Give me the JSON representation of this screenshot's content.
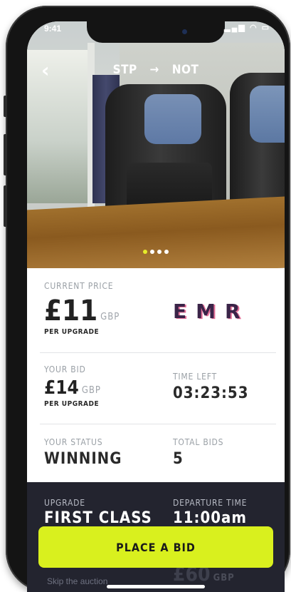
{
  "status_bar": {
    "time": "9:41",
    "icons": "signal wifi battery"
  },
  "nav": {
    "back_glyph": "‹",
    "origin": "STP",
    "arrow": "→",
    "destination": "NOT"
  },
  "carousel": {
    "count": 4,
    "active_index": 0,
    "active_color": "#e6ec2a"
  },
  "current_price": {
    "label": "CURRENT PRICE",
    "amount": "£11",
    "currency": "GBP",
    "unit": "PER UPGRADE"
  },
  "operator_logo": {
    "text": "EMR"
  },
  "your_bid": {
    "label": "YOUR BID",
    "amount": "£14",
    "currency": "GBP",
    "unit": "PER UPGRADE"
  },
  "time_left": {
    "label": "TIME LEFT",
    "value": "03:23:53"
  },
  "your_status": {
    "label": "YOUR STATUS",
    "value": "WINNING"
  },
  "total_bids": {
    "label": "TOTAL BIDS",
    "value": "5"
  },
  "upgrade": {
    "label": "UPGRADE",
    "value": "FIRST CLASS"
  },
  "departure_time": {
    "label": "DEPARTURE TIME",
    "value": "11:00am"
  },
  "skip": {
    "text": "Skip the auction"
  },
  "buy_now_price": {
    "amount": "£60",
    "currency": "GBP"
  },
  "cta": {
    "label": "PLACE A BID",
    "color": "#d9f01e"
  },
  "colors": {
    "dark_panel": "#23242f",
    "accent": "#d9f01e"
  }
}
